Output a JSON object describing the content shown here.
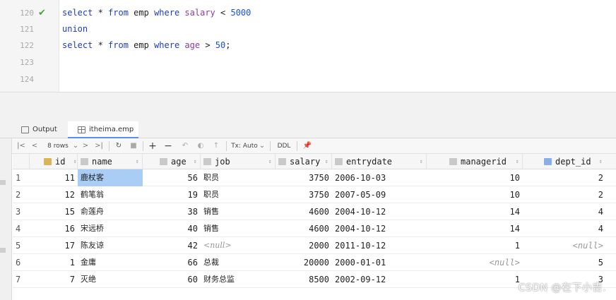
{
  "editor": {
    "lines": [
      {
        "number": "120",
        "status": "ok",
        "tokens": [
          {
            "t": "select",
            "c": "kw"
          },
          {
            "t": " * ",
            "c": "plain"
          },
          {
            "t": "from",
            "c": "kw"
          },
          {
            "t": " emp ",
            "c": "plain"
          },
          {
            "t": "where",
            "c": "kw"
          },
          {
            "t": " salary",
            "c": "col"
          },
          {
            "t": " < ",
            "c": "plain"
          },
          {
            "t": "5000",
            "c": "num"
          }
        ]
      },
      {
        "number": "121",
        "status": "",
        "tokens": [
          {
            "t": "union",
            "c": "kw"
          }
        ]
      },
      {
        "number": "122",
        "status": "",
        "tokens": [
          {
            "t": "select",
            "c": "kw"
          },
          {
            "t": " * ",
            "c": "plain"
          },
          {
            "t": "from",
            "c": "kw"
          },
          {
            "t": " emp ",
            "c": "plain"
          },
          {
            "t": "where",
            "c": "kw"
          },
          {
            "t": " age",
            "c": "col"
          },
          {
            "t": " > ",
            "c": "plain"
          },
          {
            "t": "50",
            "c": "num"
          },
          {
            "t": ";",
            "c": "plain"
          }
        ]
      },
      {
        "number": "123",
        "status": "",
        "tokens": []
      },
      {
        "number": "124",
        "status": "",
        "tokens": []
      }
    ]
  },
  "tabs": [
    {
      "label": "Output",
      "icon": "output-icon"
    },
    {
      "label": "itheima.emp",
      "icon": "table-icon"
    }
  ],
  "toolbar": {
    "first": "|<",
    "prev": "<",
    "rows_label": "8 rows",
    "rows_caret": "⌄",
    "next": ">",
    "last": ">|",
    "reload": "↻",
    "stop": "■",
    "add": "+",
    "remove": "−",
    "revert": "↶",
    "view": "◐",
    "submit": "↑",
    "tx_label": "Tx: Auto",
    "tx_caret": "⌄",
    "ddl": "DDL",
    "pin": "📌"
  },
  "grid": {
    "columns": [
      "id",
      "name",
      "age",
      "job",
      "salary",
      "entrydate",
      "managerid",
      "dept_id"
    ],
    "rows": [
      {
        "n": "1",
        "id": "11",
        "name": "鹿杖客",
        "age": "56",
        "job": "职员",
        "salary": "3750",
        "entrydate": "2006-10-03",
        "managerid": "10",
        "dept_id": "2"
      },
      {
        "n": "2",
        "id": "12",
        "name": "鹤笔翁",
        "age": "19",
        "job": "职员",
        "salary": "3750",
        "entrydate": "2007-05-09",
        "managerid": "10",
        "dept_id": "2"
      },
      {
        "n": "3",
        "id": "15",
        "name": "俞莲舟",
        "age": "38",
        "job": "销售",
        "salary": "4600",
        "entrydate": "2004-10-12",
        "managerid": "14",
        "dept_id": "4"
      },
      {
        "n": "4",
        "id": "16",
        "name": "宋远桥",
        "age": "40",
        "job": "销售",
        "salary": "4600",
        "entrydate": "2004-10-12",
        "managerid": "14",
        "dept_id": "4"
      },
      {
        "n": "5",
        "id": "17",
        "name": "陈友谅",
        "age": "42",
        "job": "<null>",
        "salary": "2000",
        "entrydate": "2011-10-12",
        "managerid": "1",
        "dept_id": "<null>"
      },
      {
        "n": "6",
        "id": "1",
        "name": "金庸",
        "age": "66",
        "job": "总裁",
        "salary": "20000",
        "entrydate": "2000-01-01",
        "managerid": "<null>",
        "dept_id": "5"
      },
      {
        "n": "7",
        "id": "7",
        "name": "灭绝",
        "age": "60",
        "job": "财务总监",
        "salary": "8500",
        "entrydate": "2002-09-12",
        "managerid": "1",
        "dept_id": "3"
      }
    ]
  },
  "watermark": "CSDN @在下小吉."
}
